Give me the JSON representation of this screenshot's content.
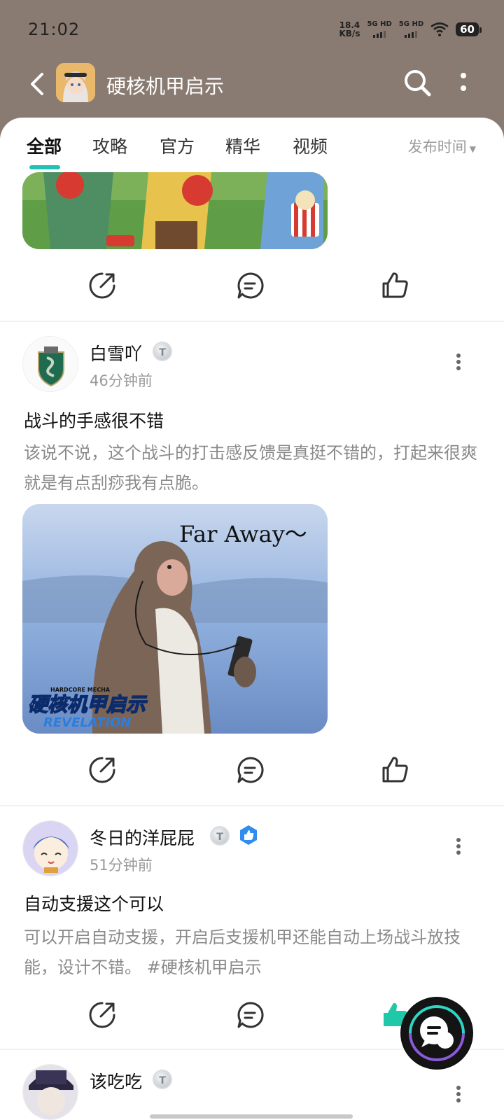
{
  "status_bar": {
    "time": "21:02",
    "net_speed_value": "18.4",
    "net_speed_unit": "KB/s",
    "sim1": "5G HD",
    "sim2": "5G HD",
    "battery": "60"
  },
  "header": {
    "title": "硬核机甲启示"
  },
  "tabs": [
    {
      "label": "全部",
      "active": true
    },
    {
      "label": "攻略"
    },
    {
      "label": "官方"
    },
    {
      "label": "精华"
    },
    {
      "label": "视频"
    }
  ],
  "sort": {
    "label": "发布时间"
  },
  "posts": [
    {
      "author": "白雪吖",
      "time": "46分钟前",
      "title": "战斗的手感很不错",
      "body": "该说不说，这个战斗的打击感反馈是真挺不错的，打起来很爽就是有点刮痧我有点脆。",
      "image_caption": "Far Away～",
      "image_logo_small": "HARDCORE MECHA",
      "image_logo_main": "硬核机甲启示",
      "image_logo_sub": "REVELATION"
    },
    {
      "author": "冬日的洋屁屁",
      "time": "51分钟前",
      "title": "自动支援这个可以",
      "body": "可以开启自动支援，开启后支援机甲还能自动上场战斗放技能，设计不错。 #硬核机甲启示"
    },
    {
      "author": "该吃吃"
    }
  ],
  "badge_letter": "T",
  "colors": {
    "header_bg": "#8a7b72",
    "accent": "#23c1b4",
    "like_active": "#1fc8a8"
  }
}
